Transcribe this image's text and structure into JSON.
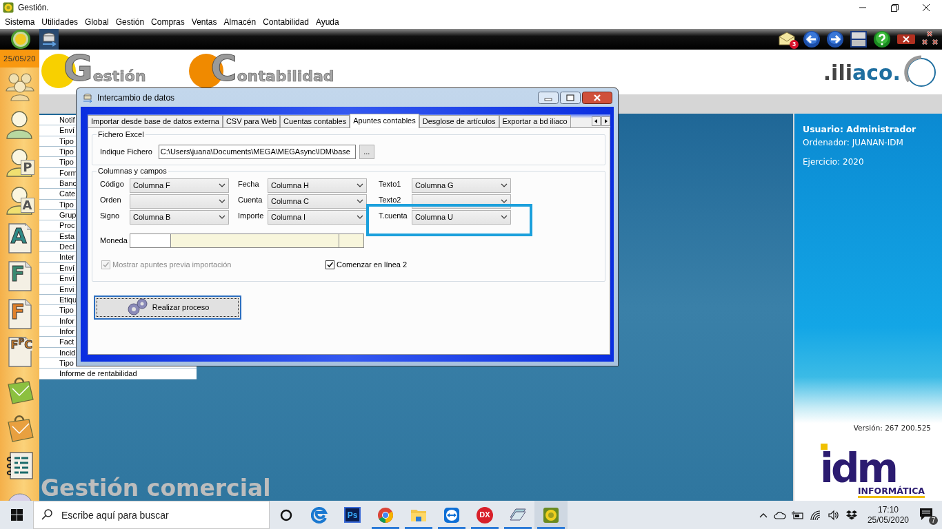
{
  "window": {
    "title": "Gestión."
  },
  "menu": [
    "Sistema",
    "Utilidades",
    "Global",
    "Gestión",
    "Compras",
    "Ventas",
    "Almacén",
    "Contabilidad",
    "Ayuda"
  ],
  "toolbar": {
    "mail_count": "3"
  },
  "sidebar": {
    "date": "25/05/20",
    "items": [
      {
        "kind": "people"
      },
      {
        "kind": "person",
        "color": "#b8d8a0"
      },
      {
        "kind": "person",
        "letter": "P",
        "color": "#f0e070"
      },
      {
        "kind": "person",
        "letter": "A",
        "color": "#f0e070"
      },
      {
        "kind": "document",
        "letter": "A",
        "color": "#2f8a86"
      },
      {
        "kind": "document",
        "letter": "F",
        "color": "#3a8a70"
      },
      {
        "kind": "document",
        "letter": "F",
        "color": "#e0802a"
      },
      {
        "kind": "document",
        "letter": "F$^{P}$C",
        "color": "#d0802a"
      },
      {
        "kind": "bag",
        "color": "#8cc040"
      },
      {
        "kind": "bag",
        "color": "#e8a040"
      },
      {
        "kind": "notebook"
      },
      {
        "kind": "disc"
      }
    ]
  },
  "header": {
    "logos": [
      {
        "initial": "G",
        "rest": "estión",
        "color": "#f8d000"
      },
      {
        "initial": "C",
        "rest": "ontabilidad",
        "color": "#f08a00"
      }
    ],
    "brand": [
      {
        "text": ".ili",
        "color": "#444444"
      },
      {
        "text": "aco.",
        "color": "#1f6fa0"
      }
    ]
  },
  "list": [
    "Notif",
    "Enví",
    "Tipo",
    "Tipo",
    "Tipo",
    "Form",
    "Banc",
    "Cate",
    "Tipo",
    "Grup",
    "Proc",
    "Esta",
    "Decl",
    "Inter",
    "Enví",
    "Enví",
    "Envi",
    "Etiqu",
    "Tipo",
    "Infor",
    "Infor",
    "Fact",
    "Incid",
    "Tipo",
    "Informe de rentabilidad"
  ],
  "module_title": "Gestión comercial",
  "info": {
    "user": "Usuario: Administrador",
    "computer": "Ordenador: JUANAN-IDM",
    "year": "Ejercicio: 2020",
    "version": "Versión: 267 200.525"
  },
  "company": {
    "name": "idm",
    "tagline": "INFORMÁTICA"
  },
  "dialog": {
    "title": "Intercambio de datos",
    "tabs": [
      {
        "label": "Importar desde base de datos externa",
        "selected": false
      },
      {
        "label": "CSV para Web",
        "selected": false
      },
      {
        "label": "Cuentas contables",
        "selected": false
      },
      {
        "label": "Apuntes contables",
        "selected": true
      },
      {
        "label": "Desglose de artículos",
        "selected": false
      },
      {
        "label": "Exportar a bd iliaco",
        "selected": false
      }
    ],
    "file_group": {
      "legend": "Fichero Excel",
      "label": "Indique Fichero",
      "value": "C:\\Users\\juana\\Documents\\MEGA\\MEGAsync\\IDM\\base",
      "browse": "..."
    },
    "fields_group": {
      "legend": "Columnas y campos",
      "fields": [
        {
          "label": "Código",
          "value": "Columna F",
          "highlighted": false
        },
        {
          "label": "Fecha",
          "value": "Columna H",
          "highlighted": false
        },
        {
          "label": "Texto1",
          "value": "Columna G",
          "highlighted": false
        },
        {
          "label": "Orden",
          "highlighted": false
        },
        {
          "label": "Cuenta",
          "value": "Columna C",
          "highlighted": false
        },
        {
          "label": "Texto2",
          "highlighted": false
        },
        {
          "label": "Signo",
          "value": "Columna B",
          "highlighted": false
        },
        {
          "label": "Importe",
          "value": "Columna I",
          "highlighted": false
        },
        {
          "label": "T.cuenta",
          "value": "Columna U",
          "highlighted": true
        }
      ],
      "currency": {
        "label": "Moneda"
      },
      "options": [
        {
          "label": "Mostrar apuntes previa importación",
          "checked": true,
          "disabled": true
        },
        {
          "label": "Comenzar en línea 2",
          "checked": true,
          "disabled": false
        }
      ]
    },
    "action": {
      "label": "Realizar proceso",
      "focused": true
    }
  },
  "taskbar": {
    "search_placeholder": "Escribe aquí para buscar",
    "apps": [
      {
        "kind": "cortana",
        "running": false,
        "active": false
      },
      {
        "kind": "edge",
        "running": false,
        "active": false
      },
      {
        "kind": "photoshop",
        "label": "Ps",
        "running": false,
        "active": false
      },
      {
        "kind": "chrome",
        "running": true,
        "active": false
      },
      {
        "kind": "explorer",
        "running": true,
        "active": false
      },
      {
        "kind": "teamviewer",
        "running": true,
        "active": false
      },
      {
        "kind": "dx",
        "label": "DX",
        "running": true,
        "active": false
      },
      {
        "kind": "stack",
        "running": true,
        "active": false
      },
      {
        "kind": "iliaco",
        "running": true,
        "active": true
      }
    ],
    "time": "17:10",
    "date": "25/05/2020",
    "notifications": "7"
  }
}
